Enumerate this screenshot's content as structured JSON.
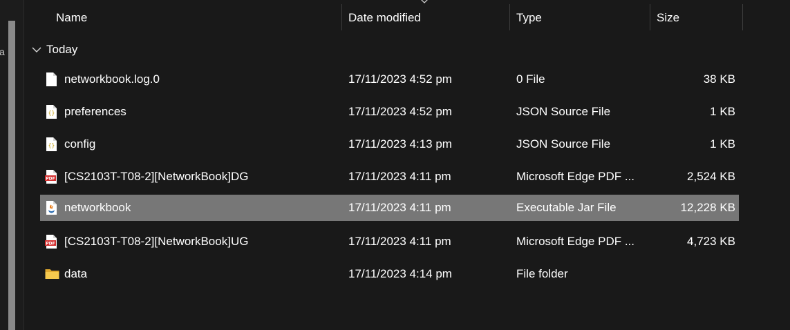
{
  "nav": {
    "clipped_char": "a"
  },
  "columns": {
    "name": "Name",
    "date_modified": "Date modified",
    "type": "Type",
    "size": "Size"
  },
  "group": {
    "label": "Today"
  },
  "rows": [
    {
      "name": "networkbook.log.0",
      "date": "17/11/2023 4:52 pm",
      "type": "0 File",
      "size": "38 KB",
      "icon": "blank-file-icon"
    },
    {
      "name": "preferences",
      "date": "17/11/2023 4:52 pm",
      "type": "JSON Source File",
      "size": "1 KB",
      "icon": "json-file-icon"
    },
    {
      "name": "config",
      "date": "17/11/2023 4:13 pm",
      "type": "JSON Source File",
      "size": "1 KB",
      "icon": "json-file-icon"
    },
    {
      "name": "[CS2103T-T08-2][NetworkBook]DG",
      "date": "17/11/2023 4:11 pm",
      "type": "Microsoft Edge PDF ...",
      "size": "2,524 KB",
      "icon": "pdf-file-icon"
    },
    {
      "name": "networkbook",
      "date": "17/11/2023 4:11 pm",
      "type": "Executable Jar File",
      "size": "12,228 KB",
      "icon": "jar-file-icon",
      "selected": true
    },
    {
      "name": "[CS2103T-T08-2][NetworkBook]UG",
      "date": "17/11/2023 4:11 pm",
      "type": "Microsoft Edge PDF ...",
      "size": "4,723 KB",
      "icon": "pdf-file-icon"
    },
    {
      "name": "data",
      "date": "17/11/2023 4:14 pm",
      "type": "File folder",
      "size": "",
      "icon": "folder-icon"
    }
  ],
  "colors": {
    "background": "#191919",
    "selected_row": "#777777",
    "text": "#ffffff"
  }
}
